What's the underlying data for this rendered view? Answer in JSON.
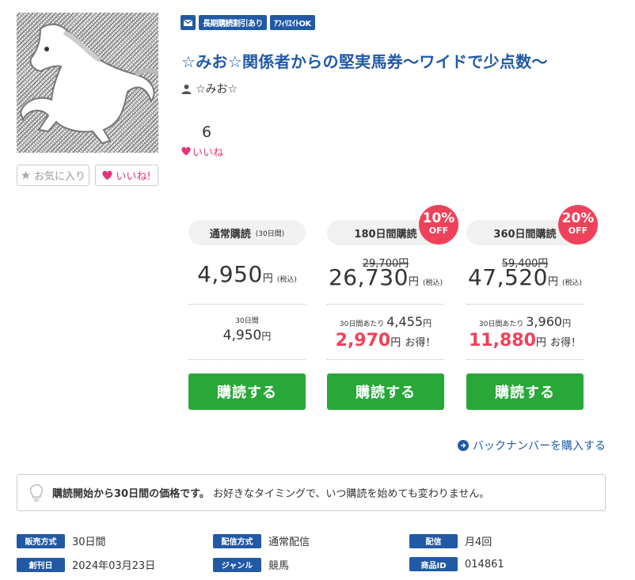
{
  "product": {
    "badges": [
      "長期購読割引あり",
      "ｱﾌｨﾘｴｲﾄOK"
    ],
    "title": "☆みお☆関係者からの堅実馬券〜ワイドで少点数〜",
    "author": "☆みお☆",
    "likes_count": "6",
    "likes_label": "いいね"
  },
  "actions": {
    "favorite_label": "お気に入り",
    "like_label": "いいね!"
  },
  "plans": [
    {
      "name": "通常購読",
      "period": "(30日間)",
      "price": "4,950",
      "yen": "円",
      "tax": "(税込)",
      "per_label": "30日間",
      "per_price": "4,950",
      "button": "購読する"
    },
    {
      "name": "180日間購読",
      "discount": "10%",
      "off": "OFF",
      "old_price": "29,700円",
      "price": "26,730",
      "yen": "円",
      "tax": "(税込)",
      "per_label": "30日間あたり",
      "per_price": "4,455",
      "saving": "2,970",
      "saving_suffix": "お得！",
      "button": "購読する"
    },
    {
      "name": "360日間購読",
      "discount": "20%",
      "off": "OFF",
      "old_price": "59,400円",
      "price": "47,520",
      "yen": "円",
      "tax": "(税込)",
      "per_label": "30日間あたり",
      "per_price": "3,960",
      "saving": "11,880",
      "saving_suffix": "お得！",
      "button": "購読する"
    }
  ],
  "backnumber_link": "バックナンバーを購入する",
  "notice": {
    "bold": "購読開始から30日間の価格です。",
    "text": "お好きなタイミングで、いつ購読を始めても変わりません。"
  },
  "meta": {
    "sales_method_label": "販売方式",
    "sales_method": "30日間",
    "delivery_method_label": "配信方式",
    "delivery_method": "通常配信",
    "delivery_label": "配信",
    "delivery": "月4回",
    "created_label": "創刊日",
    "created": "2024年03月23日",
    "genre_label": "ジャンル",
    "genre": "競馬",
    "product_id_label": "商品ID",
    "product_id": "014861"
  },
  "colors": {
    "brand_blue": "#2159a5",
    "buy_green": "#28a838",
    "discount_red": "#f0415a",
    "like_pink": "#e3347a"
  }
}
